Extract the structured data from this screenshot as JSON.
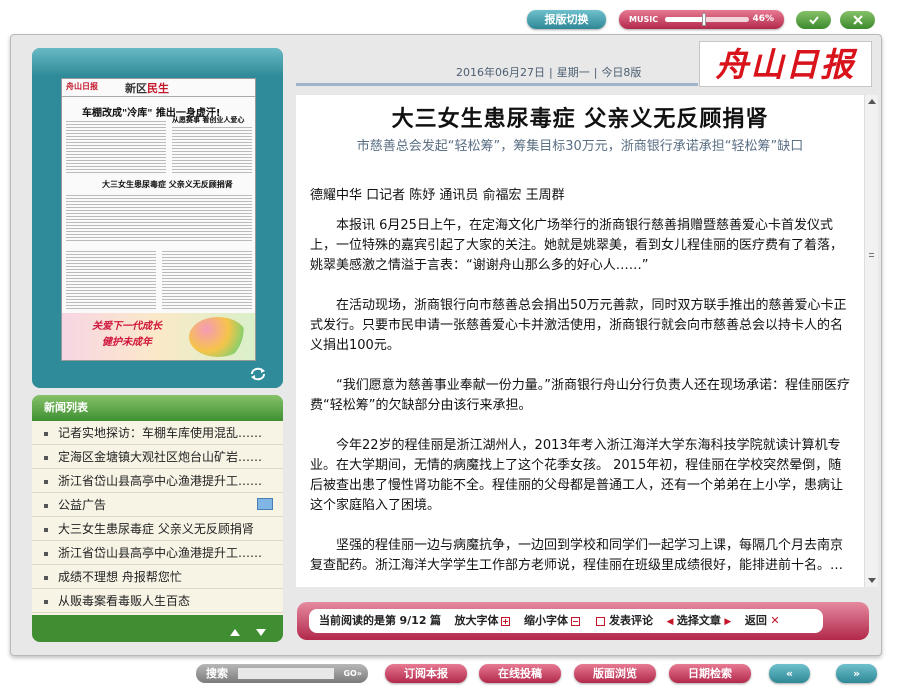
{
  "top": {
    "edition_switch": "报版切换",
    "music_label": "MUSIC",
    "music_volume": "46%",
    "music_volume_fraction": 0.46
  },
  "paper": {
    "date": "2016年06月27日",
    "weekday": "星期一",
    "pages": "今日8版",
    "logo_text": "舟山日报"
  },
  "thumbnail": {
    "logo": "舟山日报",
    "section": "新区",
    "section_red": "民生",
    "headline1": "车棚改成\"冷库\" 推出一身虚汗!",
    "headline2": "大三女生患尿毒症 父亲义无反顾捐肾",
    "headline3": "从愿赛事 看创业人爱心",
    "ad_line1": "关爱下一代成长",
    "ad_line2": "健护未成年"
  },
  "news": {
    "title": "新闻列表",
    "items": [
      "记者实地探访：车棚车库使用混乱……",
      "定海区金塘镇大观社区炮台山矿岩……",
      "浙江省岱山县高亭中心渔港提升工……",
      "公益广告",
      "大三女生患尿毒症 父亲义无反顾捐肾",
      "浙江省岱山县高亭中心渔港提升工……",
      "成绩不理想 舟报帮您忙",
      "从贩毒案看毒贩人生百态"
    ]
  },
  "article": {
    "title": "大三女生患尿毒症  父亲义无反顾捐肾",
    "subtitle": "市慈善总会发起“轻松筹”，筹集目标30万元，浙商银行承诺承担“轻松筹”缺口",
    "byline": "德耀中华   口记者 陈妤 通讯员 俞福宏 王周群",
    "paragraphs": [
      "本报讯  6月25日上午，在定海文化广场举行的浙商银行慈善捐赠暨慈善爱心卡首发仪式上，一位特殊的嘉宾引起了大家的关注。她就是姚翠美，看到女儿程佳丽的医疗费有了着落，姚翠美感激之情溢于言表：“谢谢舟山那么多的好心人……”",
      "在活动现场，浙商银行向市慈善总会捐出50万元善款，同时双方联手推出的慈善爱心卡正式发行。只要市民申请一张慈善爱心卡并激活使用，浙商银行就会向市慈善总会以持卡人的名义捐出100元。",
      "“我们愿意为慈善事业奉献一份力量。”浙商银行舟山分行负责人还在现场承诺：程佳丽医疗费“轻松筹”的欠缺部分由该行来承担。",
      "今年22岁的程佳丽是浙江湖州人，2013年考入浙江海洋大学东海科技学院就读计算机专业。在大学期间，无情的病魔找上了这个花季女孩。 2015年初，程佳丽在学校突然晕倒，随后被查出患了慢性肾功能不全。程佳丽的父母都是普通工人，还有一个弟弟在上小学，患病让这个家庭陷入了困境。",
      "坚强的程佳丽一边与病魔抗争，一边回到学校和同学们一起学习上课，每隔几个月去南京复查配药。浙江海洋大学学生工作部方老师说，程佳丽在班级里成绩很好，能排进前十名。…"
    ]
  },
  "reader": {
    "current_prefix": "当前阅读的是第",
    "current_value": "9/12",
    "current_suffix": "篇",
    "enlarge": "放大字体",
    "shrink": "缩小字体",
    "comment": "发表评论",
    "select": "选择文章",
    "back": "返回"
  },
  "bottom": {
    "search_label": "搜索",
    "search_placeholder": "",
    "search_go": "GO",
    "subscribe": "订阅本报",
    "submit": "在线投稿",
    "browse": "版面浏览",
    "date_search": "日期检索"
  },
  "colors": {
    "teal": "#2e8796",
    "pink": "#b2284b",
    "green": "#3f8f32",
    "logo_red": "#d8131b"
  }
}
